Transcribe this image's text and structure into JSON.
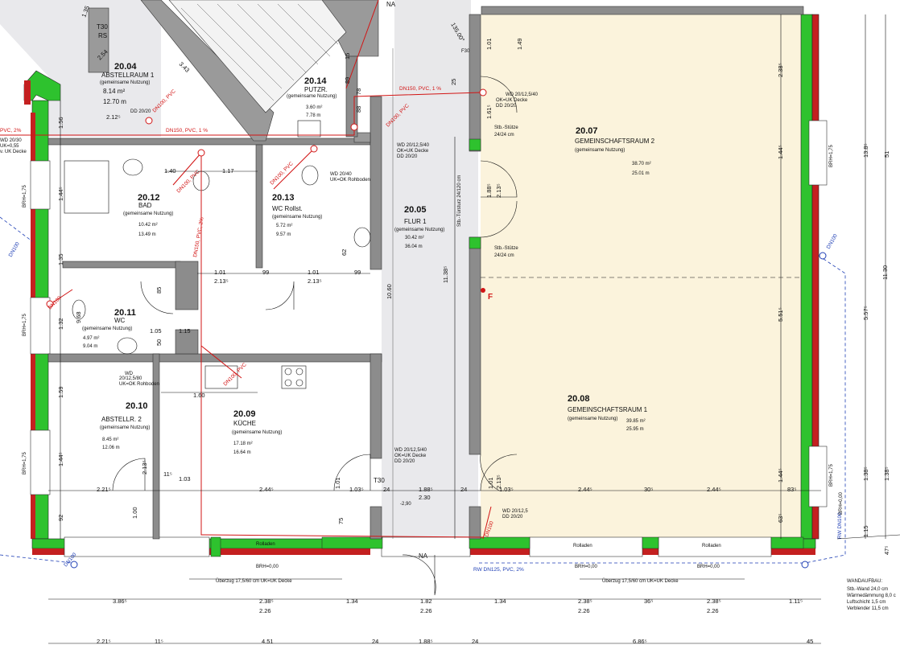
{
  "rooms": [
    {
      "id": "r2004",
      "number": "20.04",
      "name": "ABSTELLRAUM 1",
      "usage": "(gemeinsame Nutzung)",
      "area1": "8.14 m²",
      "area2": "12.70 m"
    },
    {
      "id": "r2014",
      "number": "20.14",
      "name": "PUTZR.",
      "usage": "(gemeinsame Nutzung)",
      "area1": "3.60 m²",
      "area2": "7.78 m"
    },
    {
      "id": "r2012",
      "number": "20.12",
      "name": "BAD",
      "usage": "(gemeinsame Nutzung)",
      "area1": "10.42 m²",
      "area2": "13.49 m"
    },
    {
      "id": "r2013",
      "number": "20.13",
      "name": "WC Rollst.",
      "usage": "(gemeinsame Nutzung)",
      "area1": "5.72 m²",
      "area2": "9.57 m"
    },
    {
      "id": "r2005",
      "number": "20.05",
      "name": "FLUR 1",
      "usage": "(gemeinsame Nutzung)",
      "area1": "30.42 m²",
      "area2": "36.04 m"
    },
    {
      "id": "r2007",
      "number": "20.07",
      "name": "GEMEINSCHAFTSRAUM 2",
      "usage": "(gemeinsame Nutzung)",
      "area1": "38.70 m²",
      "area2": "25.01 m"
    },
    {
      "id": "r2011",
      "number": "20.11",
      "name": "WC",
      "usage": "(gemeinsame Nutzung)",
      "area1": "4.97 m²",
      "area2": "9.04 m"
    },
    {
      "id": "r2010",
      "number": "20.10",
      "name": "ABSTELLR. 2",
      "usage": "(gemeinsame Nutzung)",
      "area1": "8.45 m²",
      "area2": "12.06 m"
    },
    {
      "id": "r2009",
      "number": "20.09",
      "name": "KÜCHE",
      "usage": "(gemeinsame Nutzung)",
      "area1": "17.18 m²",
      "area2": "16.64 m"
    },
    {
      "id": "r2008",
      "number": "20.08",
      "name": "GEMEINSCHAFTSRAUM 1",
      "usage": "(gemeinsame Nutzung)",
      "area1": "39.85 m²",
      "area2": "25.95 m"
    }
  ],
  "notes": {
    "t30_rs": "T30",
    "rs": "RS",
    "t30_bottom": "T30",
    "f30": "F30",
    "dd_2020": "DD 20/20",
    "stb_stuetze_top": "Stb.-Stütze",
    "stb_stuetze_top_size": "24/24 cm",
    "stb_stuetze_mid": "Stb.-Stütze",
    "stb_stuetze_mid_size": "24/24 cm",
    "stb_tuersturz": "Stb.-Türsturz 24/120 cm",
    "rolladen_1": "Rolladen",
    "rolladen_2": "Rolladen",
    "rolladen_3": "Rolladen",
    "ueberzug_1": "Überzug 17,5/60 cm UK=UK Decke",
    "ueberzug_2": "Überzug 17,5/60 cm UK=UK Decke",
    "brh_0_1": "BRH=0,00",
    "brh_0_2": "BRH=0,00",
    "brh_0_3": "BRH=0,00",
    "na_top": "NA",
    "na_bottom": "NA",
    "level_mark": "-2,90",
    "f_mark": "F",
    "wd_1": "WD 20/12,5/40",
    "wd_1b": "OK=UK Decke",
    "wd_1c": "DD 20/20",
    "wd_2": "WD 20/40",
    "wd_2b": "UK=OK Rohboden",
    "wd_3": "WD 20/12,5/40",
    "wd_3b": "OK=UK Decke",
    "wd_3c": "DD 20/20",
    "wd_4": "WD 20/12,5",
    "wd_4b": "DD 20/20",
    "wd_5": "WD 20/12,5/40",
    "wd_5b": "OK=UK Decke",
    "wd_5c": "DD 20/20",
    "wd_6": "WD",
    "wd_6b": "20/12,5/80",
    "wd_6c": "UK=OK Rohboden",
    "wd_7": "WD 20/30",
    "wd_7b": "UK=0,55",
    "wd_7c": "v. UK Decke"
  },
  "pipes": {
    "p1": "DN150, PVC, 1 %",
    "p2": "DN150, PVC, 1 %",
    "p3": "DN100, PVC",
    "p4": "DN100, PVC",
    "p5": "DN100, PVC",
    "p6": "DN100, PVC",
    "p7": "DN150, PVC, 2%",
    "p8": "DN100, PVC",
    "p9": "DN100",
    "p10": "DN100",
    "p11": "DN100",
    "p12": "RW DN125, PVC, 2%",
    "p13": "PVC, 2%",
    "p14": "DN100",
    "p15": "DN100",
    "p16": "RW DN100"
  },
  "brh": {
    "b1": "BRH=1,75",
    "b2": "BRH=1,75",
    "b3": "BRH=1,75",
    "b4": "BRH=1,75",
    "b5": "BRH=1,75",
    "b6": "BRH=0,00"
  },
  "wall_build": {
    "title": "WANDAUFBAU:",
    "l1": "Stb.-Wand 24,0 cm",
    "l2": "Wärmedämmung 8,0 c",
    "l3": "Luftschicht 1,5 cm",
    "l4": "Verblender 11,5 cm"
  },
  "dims": {
    "d_221": "2.21⁵",
    "d_2445a": "2.44⁵",
    "d_1035a": "1.03⁵",
    "d_24a": "24",
    "d_188": "1.88⁵",
    "d_230": "2.30",
    "d_24b": "24",
    "d_1035b": "1.03⁵",
    "d_2445b": "2.44⁵",
    "d_305": "30⁵",
    "d_2445c": "2.44⁵",
    "d_835": "83⁵",
    "d_101a": "1.01",
    "d_213a": "2.13⁵",
    "d_99a": "99",
    "d_101b": "1.01",
    "d_213b": "2.13⁵",
    "d_99b": "99",
    "d_140": "1.40",
    "d_117": "1.17",
    "d_160": "1.60",
    "d_105": "1.05",
    "d_115": "1.15",
    "d_212": "2.12⁵",
    "d_386": "3.86⁵",
    "d_2385a": "2.38⁵",
    "d_226a": "2.26",
    "d_134a": "1.34",
    "d_182": "1.82",
    "d_226b": "2.26",
    "d_134b": "1.34",
    "d_2385b": "2.38⁵",
    "d_226c": "2.26",
    "d_365": "36⁵",
    "d_2385c": "2.38⁵",
    "d_226d": "2.26",
    "d_111": "1.11⁵",
    "d_221b": "2.21⁵",
    "d_115b": "11⁵",
    "d_451": "4.51",
    "d_24c": "24",
    "d_188b": "1.88⁵",
    "d_24d": "24",
    "d_686": "6.86⁵",
    "d_45": "45",
    "v_1060": "10.60",
    "v_1138": "11.38⁵",
    "v_1130": "11.30",
    "v_1385a": "13.8⁵",
    "v_557": "5.57⁵",
    "v_51": "51",
    "v_1385b": "1.38⁵",
    "v_115": "1.15",
    "v_47": "47⁵",
    "v_138": "1.38⁵",
    "v_101": "1.01",
    "v_149": "1.49",
    "v_161": "1.61⁵",
    "v_188": "1.88⁵",
    "v_238": "2.38⁵",
    "v_144a": "1.44⁵",
    "v_551": "5.51⁵",
    "v_144b": "1.44⁵",
    "v_63": "63⁵",
    "v_156": "1.56",
    "v_144c": "1.44⁵",
    "v_135": "1.35",
    "v_132": "1.32",
    "v_159": "1.59",
    "v_144d": "1.44⁵",
    "v_92": "92",
    "v_100": "1.00",
    "v_75": "75",
    "v_968": "9.68",
    "v_101c": "1.01",
    "v_213": "2.13⁵",
    "v_213b": "2.13⁵",
    "v_15": "15",
    "v_25": "25",
    "v_89": "89",
    "v_88": "88",
    "v_62": "62",
    "v_85": "85",
    "v_50": "50",
    "v_78": "78",
    "v_103": "1.03",
    "v_115c": "11⁵",
    "v_101d": "1.01",
    "v_2135": "2.13⁵",
    "d_135": "1.35",
    "d_343": "3.43",
    "d_254": "2.54",
    "d_135b": "135.00°"
  }
}
